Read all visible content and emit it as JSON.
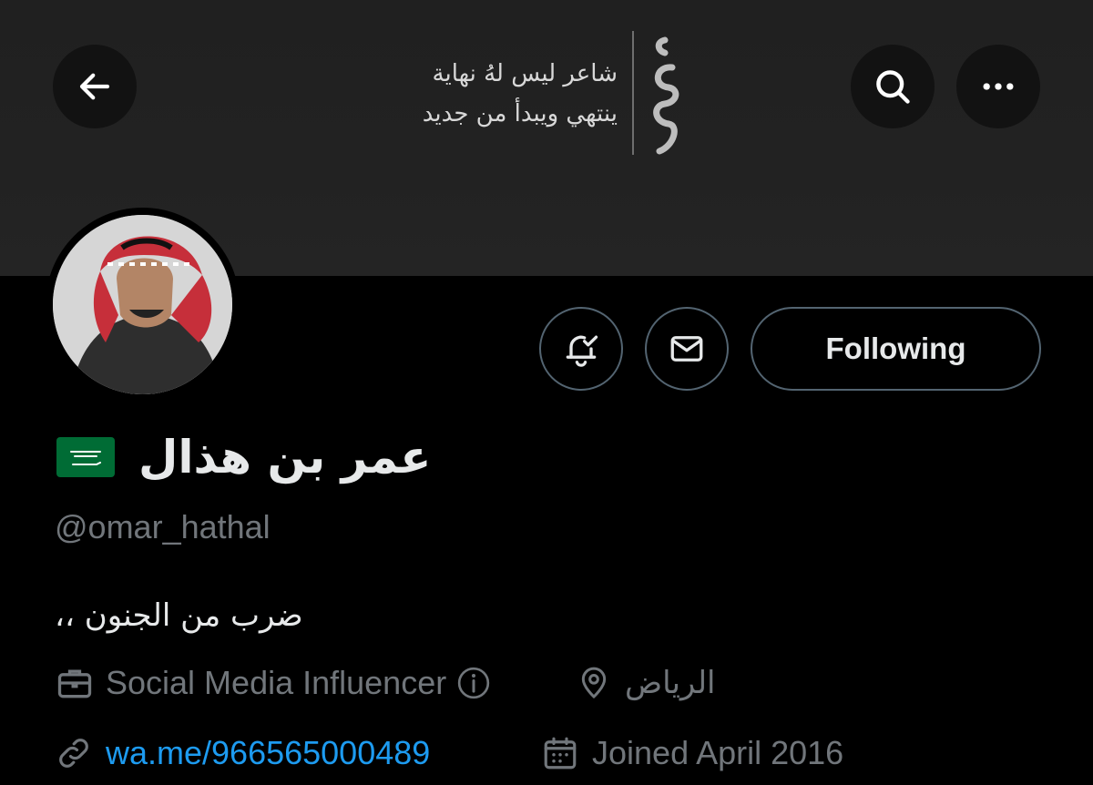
{
  "banner": {
    "line1": "شاعر ليس لهُ نهاية",
    "line2": "ينتهي ويبدأ من جديد"
  },
  "header": {
    "back_icon": "arrow-left-icon",
    "search_icon": "search-icon",
    "more_icon": "more-horizontal-icon"
  },
  "actions": {
    "notify_icon": "bell-check-icon",
    "message_icon": "envelope-icon",
    "following_label": "Following"
  },
  "profile": {
    "name": "عمر بن هذال",
    "flag_icon": "saudi-flag-icon",
    "handle": "@omar_hathal",
    "bio": "ضرب من الجنون ،،",
    "category": "Social Media Influencer",
    "location": "الرياض",
    "link": "wa.me/966565000489",
    "joined": "Joined April 2016"
  },
  "colors": {
    "background": "#000000",
    "banner": "#222222",
    "text": "#e7e9ea",
    "secondary_text": "#71767b",
    "link": "#1d9bf0",
    "button_border": "#536471",
    "flag_green": "#006c35"
  }
}
